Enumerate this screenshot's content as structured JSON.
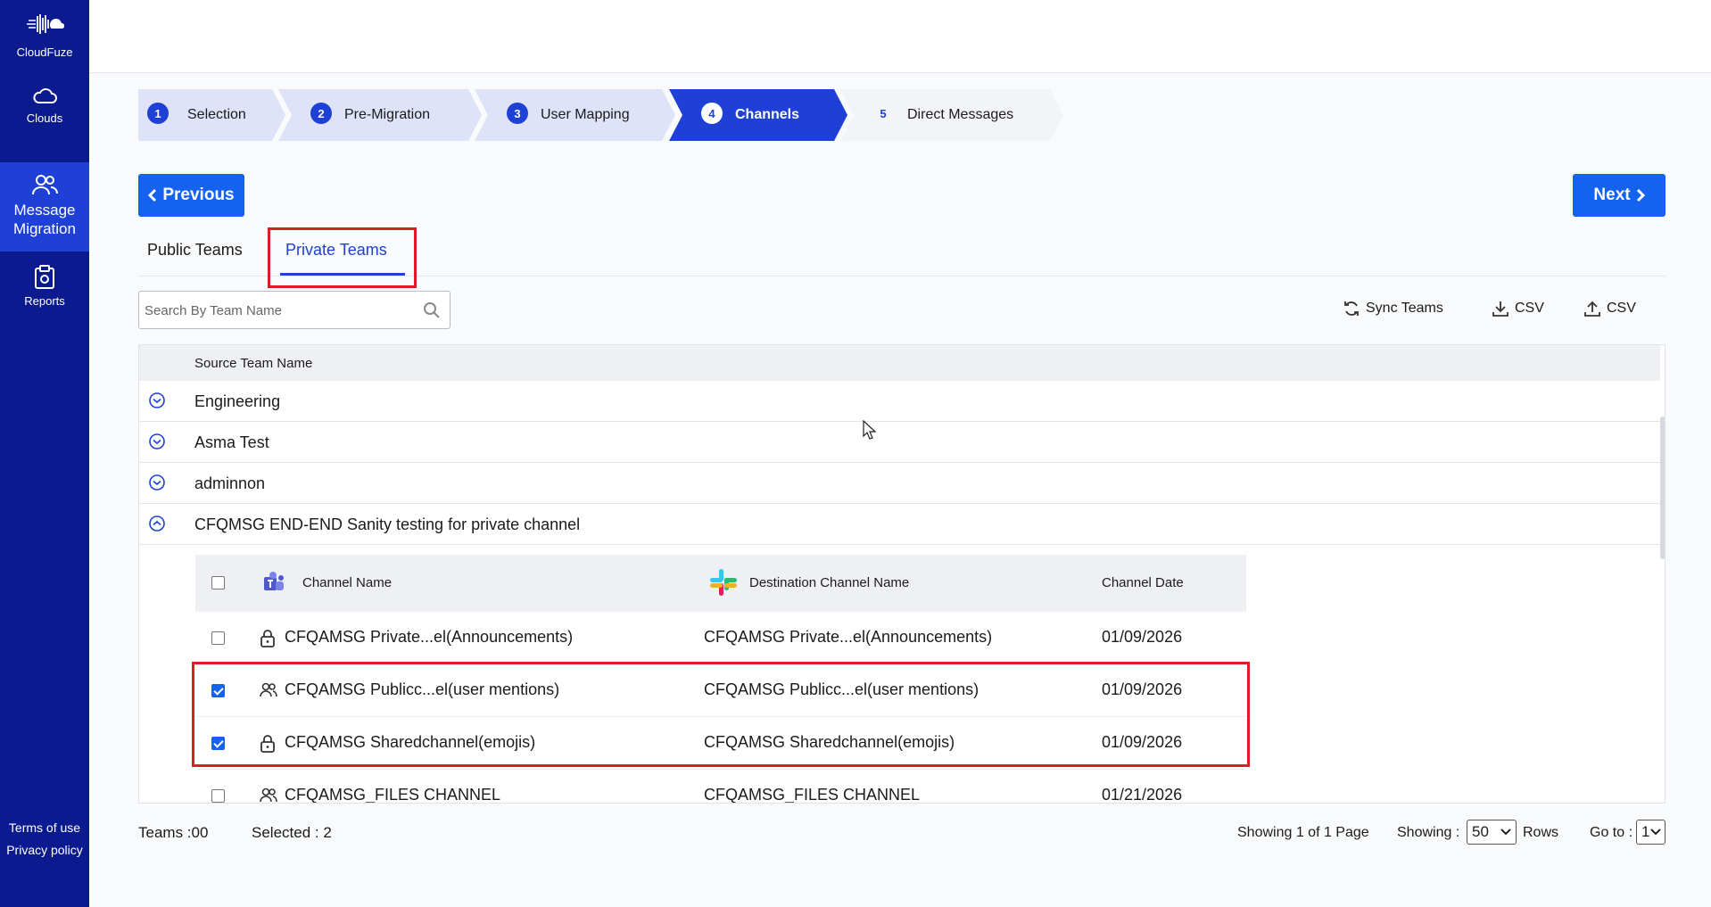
{
  "sidebar": {
    "brand": "CloudFuze",
    "items": [
      {
        "label": "Clouds",
        "icon": "cloud-icon"
      },
      {
        "label": "Message Migration",
        "icon": "users-icon"
      },
      {
        "label": "Reports",
        "icon": "clipboard-icon"
      }
    ],
    "terms": "Terms of use",
    "privacy": "Privacy policy"
  },
  "stepper": [
    {
      "num": "1",
      "label": "Selection"
    },
    {
      "num": "2",
      "label": "Pre-Migration"
    },
    {
      "num": "3",
      "label": "User Mapping"
    },
    {
      "num": "4",
      "label": "Channels"
    },
    {
      "num": "5",
      "label": "Direct Messages"
    }
  ],
  "nav": {
    "previous": "Previous",
    "next": "Next"
  },
  "tabs": {
    "public": "Public Teams",
    "private": "Private Teams"
  },
  "search": {
    "placeholder": "Search By Team Name"
  },
  "tools": {
    "sync": "Sync Teams",
    "csv_download": "CSV",
    "csv_upload": "CSV"
  },
  "table": {
    "header": "Source Team Name",
    "teams": [
      {
        "name": "Engineering",
        "expanded": false
      },
      {
        "name": "Asma Test",
        "expanded": false
      },
      {
        "name": "adminnon",
        "expanded": false
      },
      {
        "name": "CFQMSG END-END Sanity testing for private channel",
        "expanded": true
      }
    ],
    "channel_headers": {
      "channel": "Channel Name",
      "destination": "Destination Channel Name",
      "date": "Channel Date"
    },
    "channels": [
      {
        "name": "CFQAMSG Private...el(Announcements)",
        "destination": "CFQAMSG Private...el(Announcements)",
        "date": "01/09/2026",
        "checked": false,
        "icon": "lock-icon"
      },
      {
        "name": "CFQAMSG Publicc...el(user mentions)",
        "destination": "CFQAMSG Publicc...el(user mentions)",
        "date": "01/09/2026",
        "checked": true,
        "icon": "users-icon"
      },
      {
        "name": "CFQAMSG Sharedchannel(emojis)",
        "destination": "CFQAMSG Sharedchannel(emojis)",
        "date": "01/09/2026",
        "checked": true,
        "icon": "lock-icon"
      },
      {
        "name": "CFQAMSG_FILES CHANNEL",
        "destination": "CFQAMSG_FILES CHANNEL",
        "date": "01/21/2026",
        "checked": false,
        "icon": "users-icon"
      }
    ]
  },
  "footer": {
    "teams": "Teams :00",
    "selected": "Selected : 2",
    "pages": "Showing 1 of 1 Page",
    "showing": "Showing :",
    "rows_value": "50",
    "rows": "Rows",
    "goto": "Go to :",
    "goto_value": "1"
  },
  "colors": {
    "sidebar": "#0b1a8f",
    "accent": "#1e40d6",
    "button": "#1561f0",
    "highlight": "#d91f26"
  }
}
